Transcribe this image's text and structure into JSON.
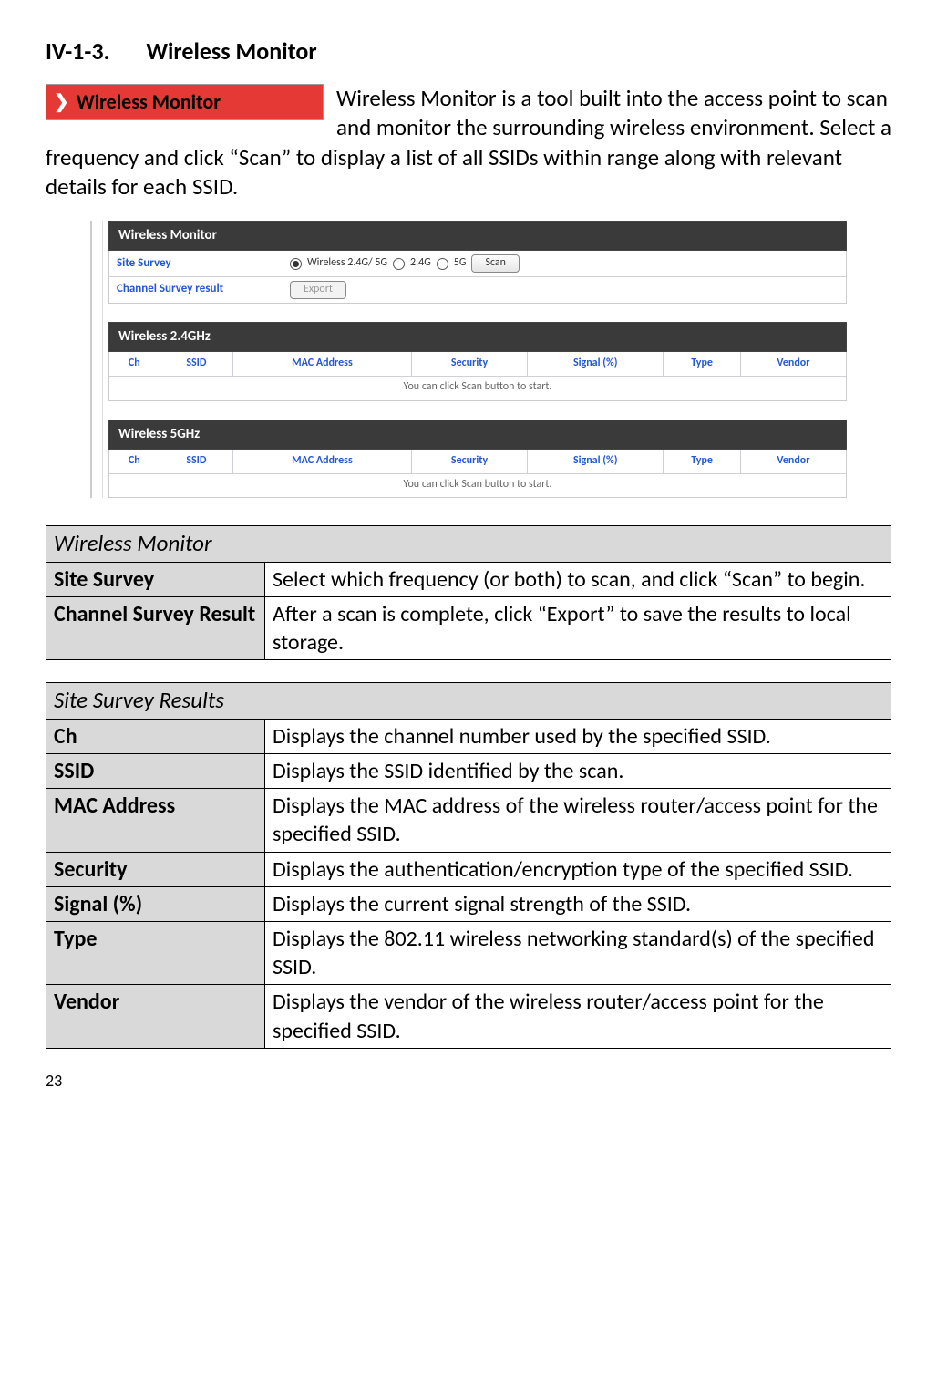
{
  "heading": {
    "number": "IV-1-3.",
    "title": "Wireless Monitor"
  },
  "nav_badge": "Wireless Monitor",
  "intro": "Wireless Monitor is a tool built into the access point to scan and monitor the surrounding wireless environment. Select a frequency and click “Scan” to display a list of all SSIDs within range along with relevant details for each SSID.",
  "panel": {
    "monitor_title": "Wireless Monitor",
    "site_survey_label": "Site Survey",
    "channel_survey_label": "Channel Survey result",
    "radio_options": [
      "Wireless 2.4G/ 5G",
      "2.4G",
      "5G"
    ],
    "scan_button": "Scan",
    "export_button": "Export",
    "band24_title": "Wireless 2.4GHz",
    "band5_title": "Wireless 5GHz",
    "columns": [
      "Ch",
      "SSID",
      "MAC Address",
      "Security",
      "Signal (%)",
      "Type",
      "Vendor"
    ],
    "empty_msg": "You can click Scan button to start."
  },
  "table1": {
    "title": "Wireless Monitor",
    "rows": [
      {
        "k": "Site Survey",
        "v": "Select which frequency (or both) to scan, and click “Scan” to begin."
      },
      {
        "k": "Channel Survey Result",
        "v": "After a scan is complete, click “Export” to save the results to local storage."
      }
    ]
  },
  "table2": {
    "title": "Site Survey Results",
    "rows": [
      {
        "k": "Ch",
        "v": "Displays the channel number used by the specified SSID."
      },
      {
        "k": "SSID",
        "v": "Displays the SSID identified by the scan."
      },
      {
        "k": "MAC Address",
        "v": "Displays the MAC address of the wireless router/access point for the specified SSID."
      },
      {
        "k": "Security",
        "v": "Displays the authentication/encryption type of the specified SSID."
      },
      {
        "k": "Signal (%)",
        "v": "Displays the current signal strength of the SSID."
      },
      {
        "k": "Type",
        "v": "Displays the 802.11 wireless networking standard(s) of the specified SSID."
      },
      {
        "k": "Vendor",
        "v": "Displays the vendor of the wireless router/access point for the specified SSID."
      }
    ]
  },
  "page_number": "23"
}
